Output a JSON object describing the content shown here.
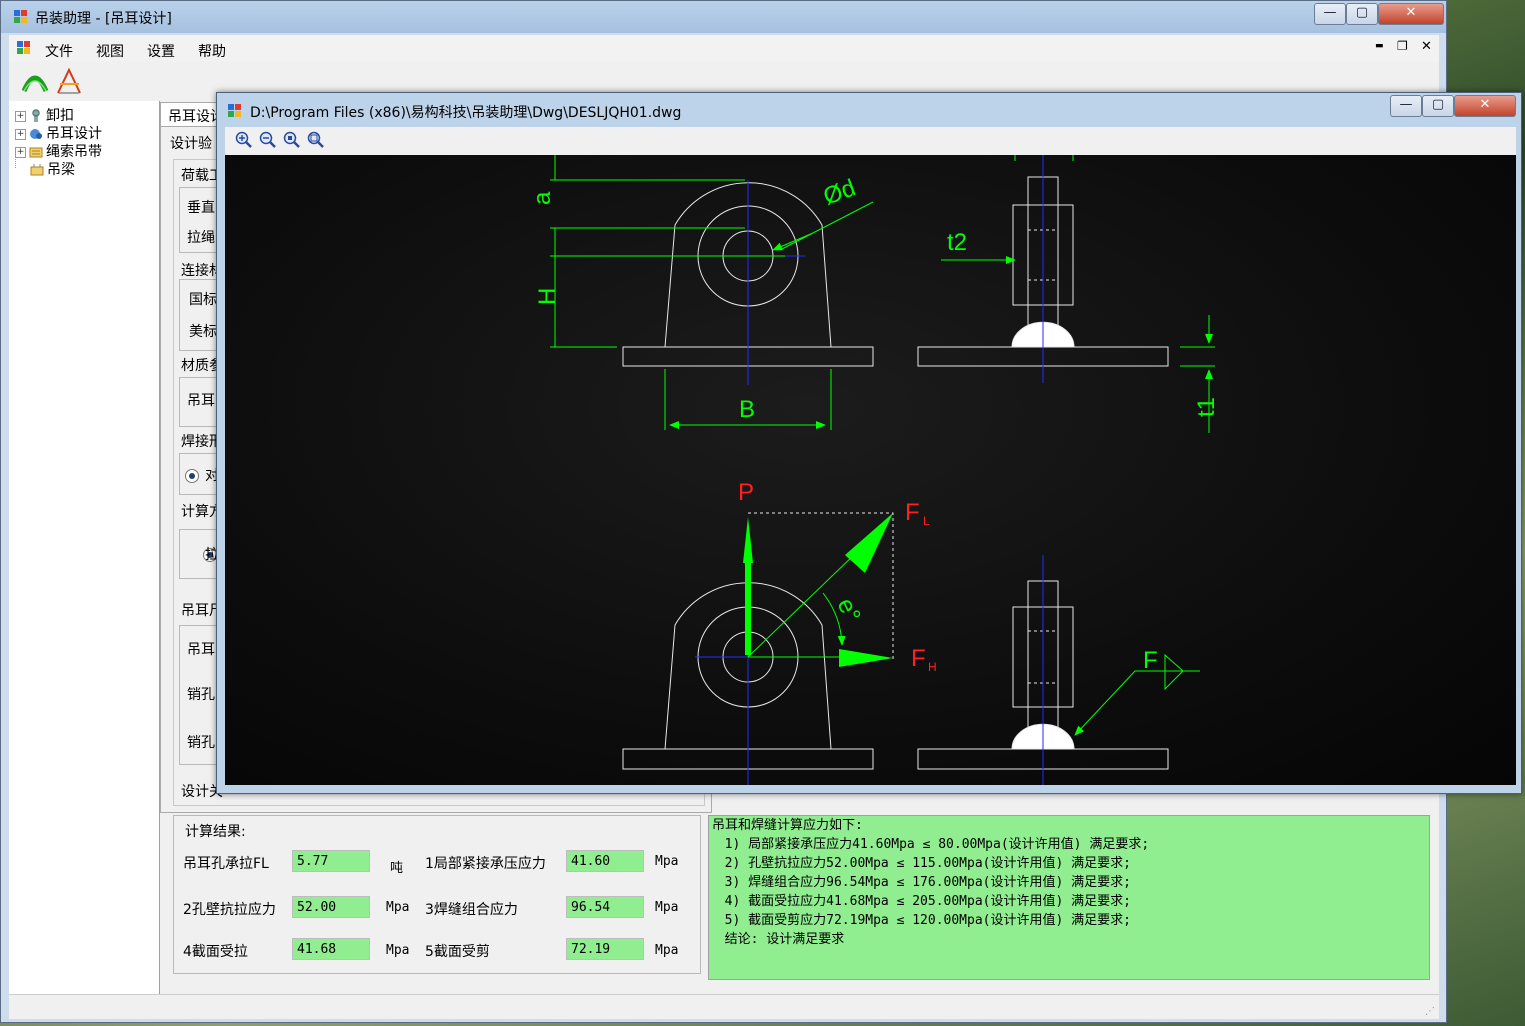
{
  "main_window": {
    "title": "吊装助理 - [吊耳设计]",
    "min": "—",
    "max": "▢",
    "close": "✕"
  },
  "menu": {
    "file": "文件",
    "view": "视图",
    "settings": "设置",
    "help": "帮助",
    "mdi_min": "▬",
    "mdi_restore": "❐",
    "mdi_close": "✕"
  },
  "tree": {
    "items": [
      {
        "label": "卸扣",
        "plus": "+"
      },
      {
        "label": "吊耳设计",
        "plus": "+"
      },
      {
        "label": "绳索吊带",
        "plus": "+"
      },
      {
        "label": "吊梁",
        "plus": ""
      }
    ]
  },
  "form": {
    "tab_label": "吊耳设计",
    "sub_label": "设计验",
    "load_group": "荷载工",
    "vertical": "垂直",
    "rope": "拉绳",
    "connect_group": "连接材",
    "gb": "国标",
    "us": "美标",
    "material_group": "材质参",
    "lug": "吊耳",
    "weld_group": "焊接形",
    "weld_opt": "对",
    "calc_group": "计算方",
    "calc_opt": "拉",
    "lug_size_group": "吊耳尺",
    "lug_row": "吊耳",
    "pin1": "销孔",
    "pin2": "销孔",
    "design_result": "设计关"
  },
  "results": {
    "title": "计算结果:",
    "rows": [
      {
        "l1": "吊耳孔承拉FL",
        "v1": "5.77",
        "u1": "吨",
        "l2": "1局部紧接承压应力",
        "v2": "41.60",
        "u2": "Mpa"
      },
      {
        "l1": "2孔壁抗拉应力",
        "v1": "52.00",
        "u1": "Mpa",
        "l2": "3焊缝组合应力",
        "v2": "96.54",
        "u2": "Mpa"
      },
      {
        "l1": "4截面受拉",
        "v1": "41.68",
        "u1": "Mpa",
        "l2": "5截面受剪",
        "v2": "72.19",
        "u2": "Mpa"
      }
    ]
  },
  "result_text": {
    "lines": [
      "吊耳和焊缝计算应力如下:",
      "  1) 局部紧接承压应力41.60Mpa ≤ 80.00Mpa(设计许用值) 满足要求;",
      "  2) 孔壁抗拉应力52.00Mpa ≤ 115.00Mpa(设计许用值) 满足要求;",
      "  3) 焊缝组合应力96.54Mpa ≤ 176.00Mpa(设计许用值) 满足要求;",
      "  4) 截面受拉应力41.68Mpa ≤ 205.00Mpa(设计许用值) 满足要求;",
      "  5) 截面受剪应力72.19Mpa ≤ 120.00Mpa(设计许用值) 满足要求;",
      "  结论: 设计满足要求"
    ]
  },
  "dwg_window": {
    "title": "D:\\Program Files (x86)\\易构科技\\吊装助理\\Dwg\\DESLJQH01.dwg",
    "min": "—",
    "max": "▢",
    "close": "✕"
  },
  "drawing": {
    "labels": {
      "a": "a",
      "d": "Ød",
      "t2": "t2",
      "H": "H",
      "B": "B",
      "t1": "t1",
      "P": "P",
      "FL": "F",
      "FL_sub": "L",
      "theta": "e°",
      "FH": "F",
      "FH_sub": "H",
      "F": "F"
    },
    "colors": {
      "green": "#00ff00",
      "red": "#ff2020",
      "white": "#e8e8e8",
      "blue": "#2030ff"
    }
  }
}
